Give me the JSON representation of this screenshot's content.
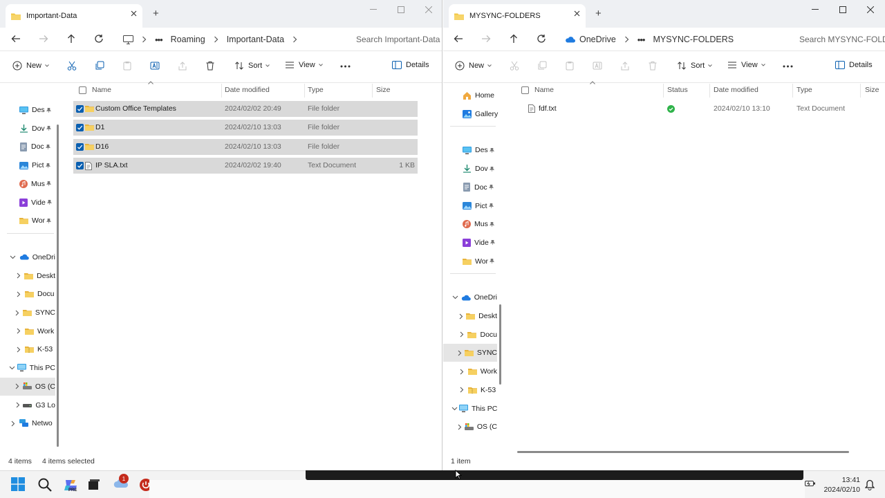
{
  "left": {
    "tab_title": "Important-Data",
    "breadcrumb": [
      "Roaming",
      "Important-Data"
    ],
    "search_placeholder": "Search Important-Data",
    "toolbar": {
      "new": "New",
      "sort": "Sort",
      "view": "View",
      "details": "Details"
    },
    "nav_quick": [
      {
        "label": "Des",
        "icon": "desktop-icon"
      },
      {
        "label": "Dov",
        "icon": "download-icon"
      },
      {
        "label": "Doc",
        "icon": "document-icon"
      },
      {
        "label": "Pict",
        "icon": "pictures-icon"
      },
      {
        "label": "Mus",
        "icon": "music-icon"
      },
      {
        "label": "Vide",
        "icon": "video-icon"
      },
      {
        "label": "Wor",
        "icon": "folder-icon"
      }
    ],
    "nav_tree": [
      {
        "label": "OneDri",
        "icon": "cloud-icon",
        "level": 0,
        "expanded": true
      },
      {
        "label": "Deskt",
        "icon": "folder-icon",
        "level": 1
      },
      {
        "label": "Docu",
        "icon": "folder-icon",
        "level": 1
      },
      {
        "label": "SYNC",
        "icon": "folder-icon",
        "level": 1
      },
      {
        "label": "Work",
        "icon": "folder-icon",
        "level": 1
      },
      {
        "label": "K-53",
        "icon": "folder-zip-icon",
        "level": 1
      },
      {
        "label": "This PC",
        "icon": "monitor-icon",
        "level": 0,
        "expanded": true
      },
      {
        "label": "OS (C",
        "icon": "drive-os-icon",
        "level": 1,
        "selected": true
      },
      {
        "label": "G3 Lo",
        "icon": "drive-icon",
        "level": 1
      },
      {
        "label": "Netwo",
        "icon": "network-icon",
        "level": 0
      }
    ],
    "columns": [
      "Name",
      "Date modified",
      "Type",
      "Size"
    ],
    "files": [
      {
        "name": "Custom Office Templates",
        "date": "2024/02/02 20:49",
        "type": "File folder",
        "size": "",
        "icon": "folder"
      },
      {
        "name": "D1",
        "date": "2024/02/10 13:03",
        "type": "File folder",
        "size": "",
        "icon": "folder"
      },
      {
        "name": "D16",
        "date": "2024/02/10 13:03",
        "type": "File folder",
        "size": "",
        "icon": "folder"
      },
      {
        "name": "IP SLA.txt",
        "date": "2024/02/02 19:40",
        "type": "Text Document",
        "size": "1 KB",
        "icon": "text"
      }
    ],
    "status": {
      "items": "4 items",
      "selected": "4 items selected"
    }
  },
  "right": {
    "tab_title": "MYSYNC-FOLDERS",
    "breadcrumb": [
      "OneDrive",
      "MYSYNC-FOLDERS"
    ],
    "search_placeholder": "Search MYSYNC-FOLDERS",
    "toolbar": {
      "new": "New",
      "sort": "Sort",
      "view": "View",
      "details": "Details"
    },
    "nav_top": [
      {
        "label": "Home",
        "icon": "home-icon"
      },
      {
        "label": "Gallery",
        "icon": "gallery-icon"
      }
    ],
    "nav_quick": [
      {
        "label": "Des",
        "icon": "desktop-icon"
      },
      {
        "label": "Dov",
        "icon": "download-icon"
      },
      {
        "label": "Doc",
        "icon": "document-icon"
      },
      {
        "label": "Pict",
        "icon": "pictures-icon"
      },
      {
        "label": "Mus",
        "icon": "music-icon"
      },
      {
        "label": "Vide",
        "icon": "video-icon"
      },
      {
        "label": "Wor",
        "icon": "folder-icon"
      }
    ],
    "nav_tree": [
      {
        "label": "OneDri",
        "icon": "cloud-icon",
        "level": 0,
        "expanded": true
      },
      {
        "label": "Deskt",
        "icon": "folder-icon",
        "level": 1
      },
      {
        "label": "Docu",
        "icon": "folder-icon",
        "level": 1
      },
      {
        "label": "SYNC",
        "icon": "folder-icon",
        "level": 1,
        "selected": true
      },
      {
        "label": "Work",
        "icon": "folder-icon",
        "level": 1
      },
      {
        "label": "K-53",
        "icon": "folder-zip-icon",
        "level": 1
      },
      {
        "label": "This PC",
        "icon": "monitor-icon",
        "level": 0,
        "expanded": true
      },
      {
        "label": "OS (C",
        "icon": "drive-os-icon",
        "level": 1
      }
    ],
    "columns": [
      "Name",
      "Status",
      "Date modified",
      "Type",
      "Size"
    ],
    "files": [
      {
        "name": "fdf.txt",
        "status": "synced",
        "date": "2024/02/10 13:10",
        "type": "Text Document",
        "size": "",
        "icon": "text"
      }
    ],
    "status": {
      "items": "1 item"
    }
  },
  "taskbar": {
    "time": "13:41",
    "date": "2024/02/10",
    "badge_count": "1",
    "copilot_label": "PRE"
  },
  "colors": {
    "accent": "#0a5fb0",
    "folder": "#f2c744",
    "sync_ok": "#2fb34a",
    "badge": "#c42b1c"
  }
}
